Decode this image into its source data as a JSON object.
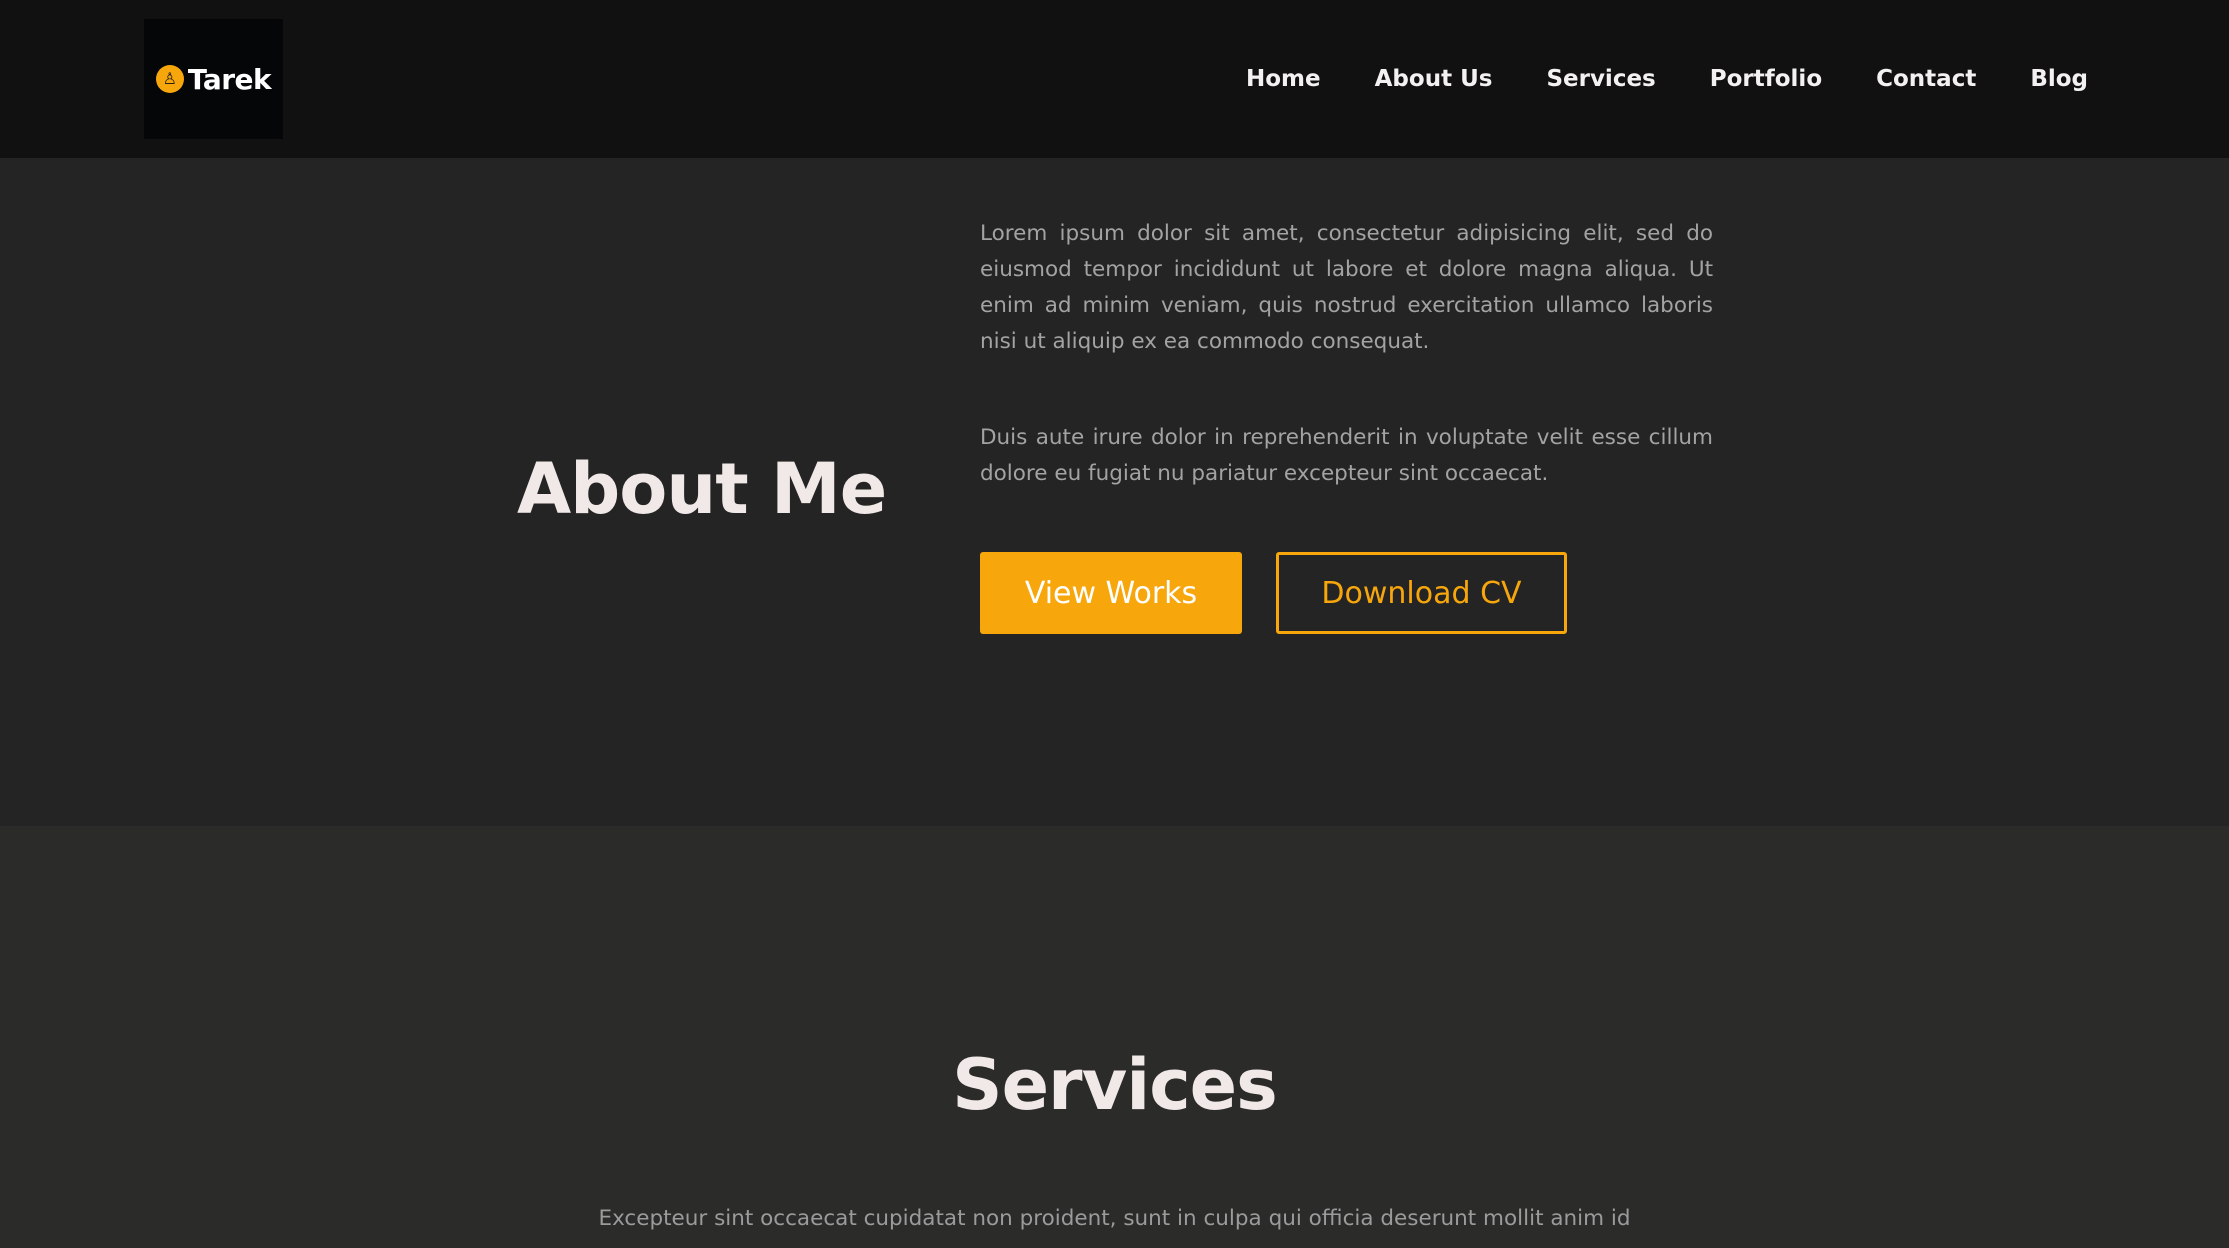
{
  "header": {
    "logo_text": "Tarek",
    "logo_icon": "sun-logo-icon",
    "nav": [
      {
        "label": "Home"
      },
      {
        "label": "About Us"
      },
      {
        "label": "Services"
      },
      {
        "label": "Portfolio"
      },
      {
        "label": "Contact"
      },
      {
        "label": "Blog"
      }
    ]
  },
  "about": {
    "title": "About Me",
    "paragraph1": "Lorem ipsum dolor sit amet, consectetur adipisicing elit, sed do eiusmod tempor incididunt ut labore et dolore magna aliqua. Ut enim ad minim veniam, quis nostrud exercitation ullamco laboris nisi ut aliquip ex ea commodo consequat.",
    "paragraph2": "Duis aute irure dolor in reprehenderit in voluptate velit esse cillum dolore eu fugiat nu pariatur excepteur sint occaecat.",
    "primary_button": "View Works",
    "secondary_button": "Download CV"
  },
  "services": {
    "title": "Services",
    "text": "Excepteur sint occaecat cupidatat non proident, sunt in culpa qui officia deserunt mollit anim id"
  },
  "colors": {
    "accent": "#f7a60c",
    "header_bg": "#121112",
    "about_bg": "#252424",
    "services_bg": "#2b2b2a",
    "heading": "#f1e8e8",
    "body_text": "#a3a3a3"
  }
}
